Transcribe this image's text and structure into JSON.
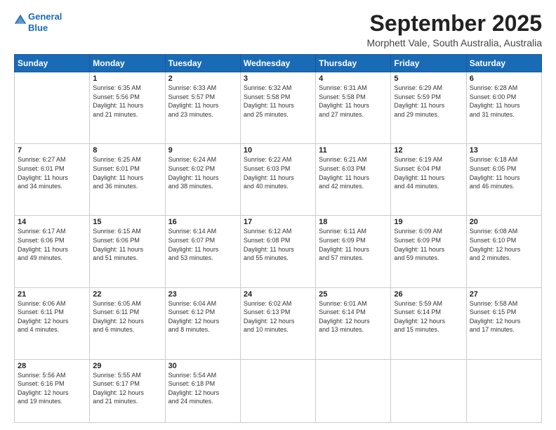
{
  "header": {
    "logo_line1": "General",
    "logo_line2": "Blue",
    "month": "September 2025",
    "location": "Morphett Vale, South Australia, Australia"
  },
  "weekdays": [
    "Sunday",
    "Monday",
    "Tuesday",
    "Wednesday",
    "Thursday",
    "Friday",
    "Saturday"
  ],
  "weeks": [
    [
      {
        "day": "",
        "info": ""
      },
      {
        "day": "1",
        "info": "Sunrise: 6:35 AM\nSunset: 5:56 PM\nDaylight: 11 hours\nand 21 minutes."
      },
      {
        "day": "2",
        "info": "Sunrise: 6:33 AM\nSunset: 5:57 PM\nDaylight: 11 hours\nand 23 minutes."
      },
      {
        "day": "3",
        "info": "Sunrise: 6:32 AM\nSunset: 5:58 PM\nDaylight: 11 hours\nand 25 minutes."
      },
      {
        "day": "4",
        "info": "Sunrise: 6:31 AM\nSunset: 5:58 PM\nDaylight: 11 hours\nand 27 minutes."
      },
      {
        "day": "5",
        "info": "Sunrise: 6:29 AM\nSunset: 5:59 PM\nDaylight: 11 hours\nand 29 minutes."
      },
      {
        "day": "6",
        "info": "Sunrise: 6:28 AM\nSunset: 6:00 PM\nDaylight: 11 hours\nand 31 minutes."
      }
    ],
    [
      {
        "day": "7",
        "info": "Sunrise: 6:27 AM\nSunset: 6:01 PM\nDaylight: 11 hours\nand 34 minutes."
      },
      {
        "day": "8",
        "info": "Sunrise: 6:25 AM\nSunset: 6:01 PM\nDaylight: 11 hours\nand 36 minutes."
      },
      {
        "day": "9",
        "info": "Sunrise: 6:24 AM\nSunset: 6:02 PM\nDaylight: 11 hours\nand 38 minutes."
      },
      {
        "day": "10",
        "info": "Sunrise: 6:22 AM\nSunset: 6:03 PM\nDaylight: 11 hours\nand 40 minutes."
      },
      {
        "day": "11",
        "info": "Sunrise: 6:21 AM\nSunset: 6:03 PM\nDaylight: 11 hours\nand 42 minutes."
      },
      {
        "day": "12",
        "info": "Sunrise: 6:19 AM\nSunset: 6:04 PM\nDaylight: 11 hours\nand 44 minutes."
      },
      {
        "day": "13",
        "info": "Sunrise: 6:18 AM\nSunset: 6:05 PM\nDaylight: 11 hours\nand 46 minutes."
      }
    ],
    [
      {
        "day": "14",
        "info": "Sunrise: 6:17 AM\nSunset: 6:06 PM\nDaylight: 11 hours\nand 49 minutes."
      },
      {
        "day": "15",
        "info": "Sunrise: 6:15 AM\nSunset: 6:06 PM\nDaylight: 11 hours\nand 51 minutes."
      },
      {
        "day": "16",
        "info": "Sunrise: 6:14 AM\nSunset: 6:07 PM\nDaylight: 11 hours\nand 53 minutes."
      },
      {
        "day": "17",
        "info": "Sunrise: 6:12 AM\nSunset: 6:08 PM\nDaylight: 11 hours\nand 55 minutes."
      },
      {
        "day": "18",
        "info": "Sunrise: 6:11 AM\nSunset: 6:09 PM\nDaylight: 11 hours\nand 57 minutes."
      },
      {
        "day": "19",
        "info": "Sunrise: 6:09 AM\nSunset: 6:09 PM\nDaylight: 11 hours\nand 59 minutes."
      },
      {
        "day": "20",
        "info": "Sunrise: 6:08 AM\nSunset: 6:10 PM\nDaylight: 12 hours\nand 2 minutes."
      }
    ],
    [
      {
        "day": "21",
        "info": "Sunrise: 6:06 AM\nSunset: 6:11 PM\nDaylight: 12 hours\nand 4 minutes."
      },
      {
        "day": "22",
        "info": "Sunrise: 6:05 AM\nSunset: 6:11 PM\nDaylight: 12 hours\nand 6 minutes."
      },
      {
        "day": "23",
        "info": "Sunrise: 6:04 AM\nSunset: 6:12 PM\nDaylight: 12 hours\nand 8 minutes."
      },
      {
        "day": "24",
        "info": "Sunrise: 6:02 AM\nSunset: 6:13 PM\nDaylight: 12 hours\nand 10 minutes."
      },
      {
        "day": "25",
        "info": "Sunrise: 6:01 AM\nSunset: 6:14 PM\nDaylight: 12 hours\nand 13 minutes."
      },
      {
        "day": "26",
        "info": "Sunrise: 5:59 AM\nSunset: 6:14 PM\nDaylight: 12 hours\nand 15 minutes."
      },
      {
        "day": "27",
        "info": "Sunrise: 5:58 AM\nSunset: 6:15 PM\nDaylight: 12 hours\nand 17 minutes."
      }
    ],
    [
      {
        "day": "28",
        "info": "Sunrise: 5:56 AM\nSunset: 6:16 PM\nDaylight: 12 hours\nand 19 minutes."
      },
      {
        "day": "29",
        "info": "Sunrise: 5:55 AM\nSunset: 6:17 PM\nDaylight: 12 hours\nand 21 minutes."
      },
      {
        "day": "30",
        "info": "Sunrise: 5:54 AM\nSunset: 6:18 PM\nDaylight: 12 hours\nand 24 minutes."
      },
      {
        "day": "",
        "info": ""
      },
      {
        "day": "",
        "info": ""
      },
      {
        "day": "",
        "info": ""
      },
      {
        "day": "",
        "info": ""
      }
    ]
  ]
}
